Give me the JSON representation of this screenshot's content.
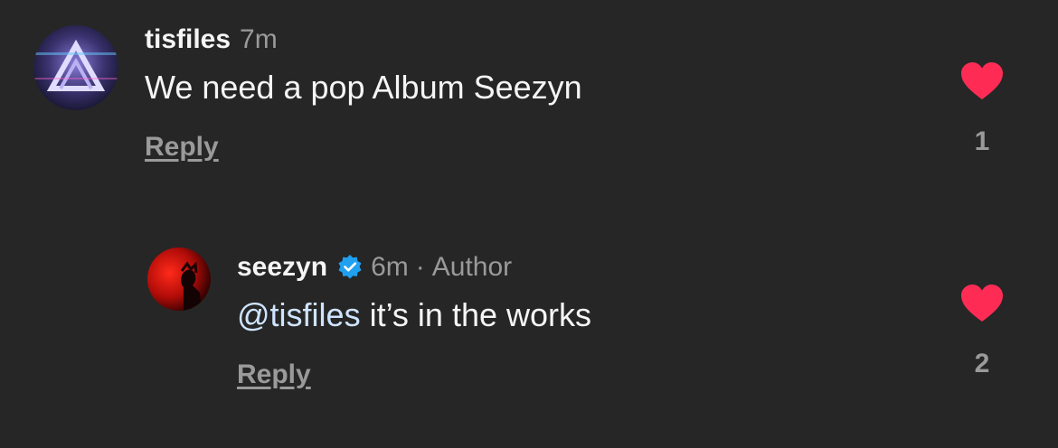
{
  "comments": [
    {
      "username": "tisfiles",
      "time": "7m",
      "text": "We need a pop Album Seezyn",
      "reply_label": "Reply",
      "like_count": "1",
      "icons": {
        "avatar": "user-avatar",
        "like": "heart-icon"
      }
    },
    {
      "username": "seezyn",
      "verified": true,
      "time": "6m",
      "separator": "·",
      "author_label": "Author",
      "mention": "@tisfiles",
      "text": " it’s in the works",
      "reply_label": "Reply",
      "like_count": "2",
      "icons": {
        "avatar": "user-avatar",
        "verified": "verified-badge-icon",
        "like": "heart-icon"
      }
    }
  ],
  "colors": {
    "background": "#262626",
    "heart": "#fe2c55",
    "verified": "#20a0f0",
    "secondary_text": "#9a9a9a",
    "mention": "#cfe4ff"
  }
}
